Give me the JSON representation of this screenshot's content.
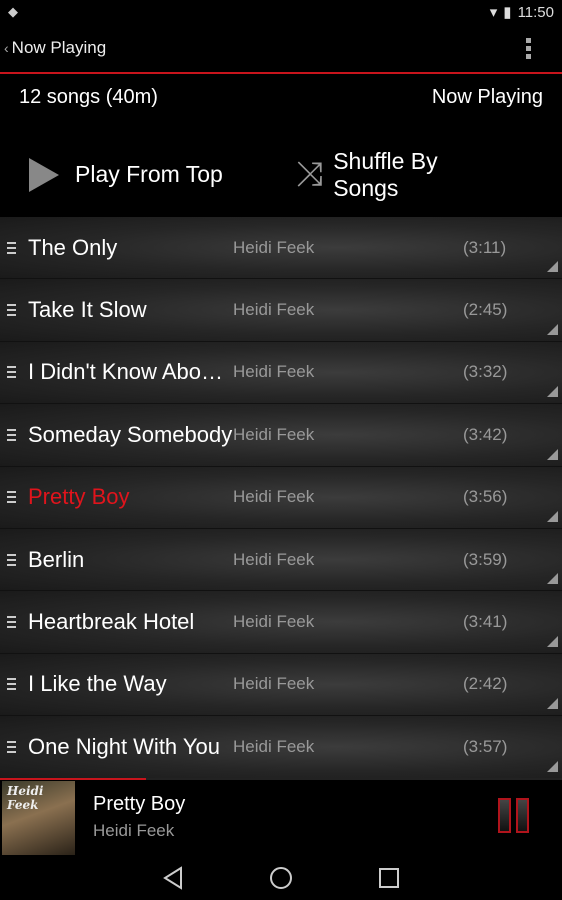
{
  "status": {
    "time": "11:50"
  },
  "actionbar": {
    "back_title": "Now Playing"
  },
  "info": {
    "count": "12 songs (40m)",
    "label": "Now Playing"
  },
  "actions": {
    "play": "Play From Top",
    "shuffle": "Shuffle By Songs"
  },
  "songs": [
    {
      "title": "The Only",
      "artist": "Heidi Feek",
      "duration": "(3:11)"
    },
    {
      "title": "Take It Slow",
      "artist": "Heidi Feek",
      "duration": "(2:45)"
    },
    {
      "title": "I Didn't Know About You",
      "artist": "Heidi Feek",
      "duration": "(3:32)"
    },
    {
      "title": "Someday Somebody",
      "artist": "Heidi Feek",
      "duration": "(3:42)"
    },
    {
      "title": "Pretty Boy",
      "artist": "Heidi Feek",
      "duration": "(3:56)",
      "playing": true
    },
    {
      "title": "Berlin",
      "artist": "Heidi Feek",
      "duration": "(3:59)"
    },
    {
      "title": "Heartbreak Hotel",
      "artist": "Heidi Feek",
      "duration": "(3:41)"
    },
    {
      "title": "I Like the Way",
      "artist": "Heidi Feek",
      "duration": "(2:42)"
    },
    {
      "title": "One Night With You",
      "artist": "Heidi Feek",
      "duration": "(3:57)"
    }
  ],
  "mini": {
    "title": "Pretty Boy",
    "artist": "Heidi Feek",
    "art_text": "Heidi Feek",
    "progress_fraction": 0.26
  },
  "colors": {
    "accent": "#c8141c",
    "active_song": "#e0141c"
  }
}
